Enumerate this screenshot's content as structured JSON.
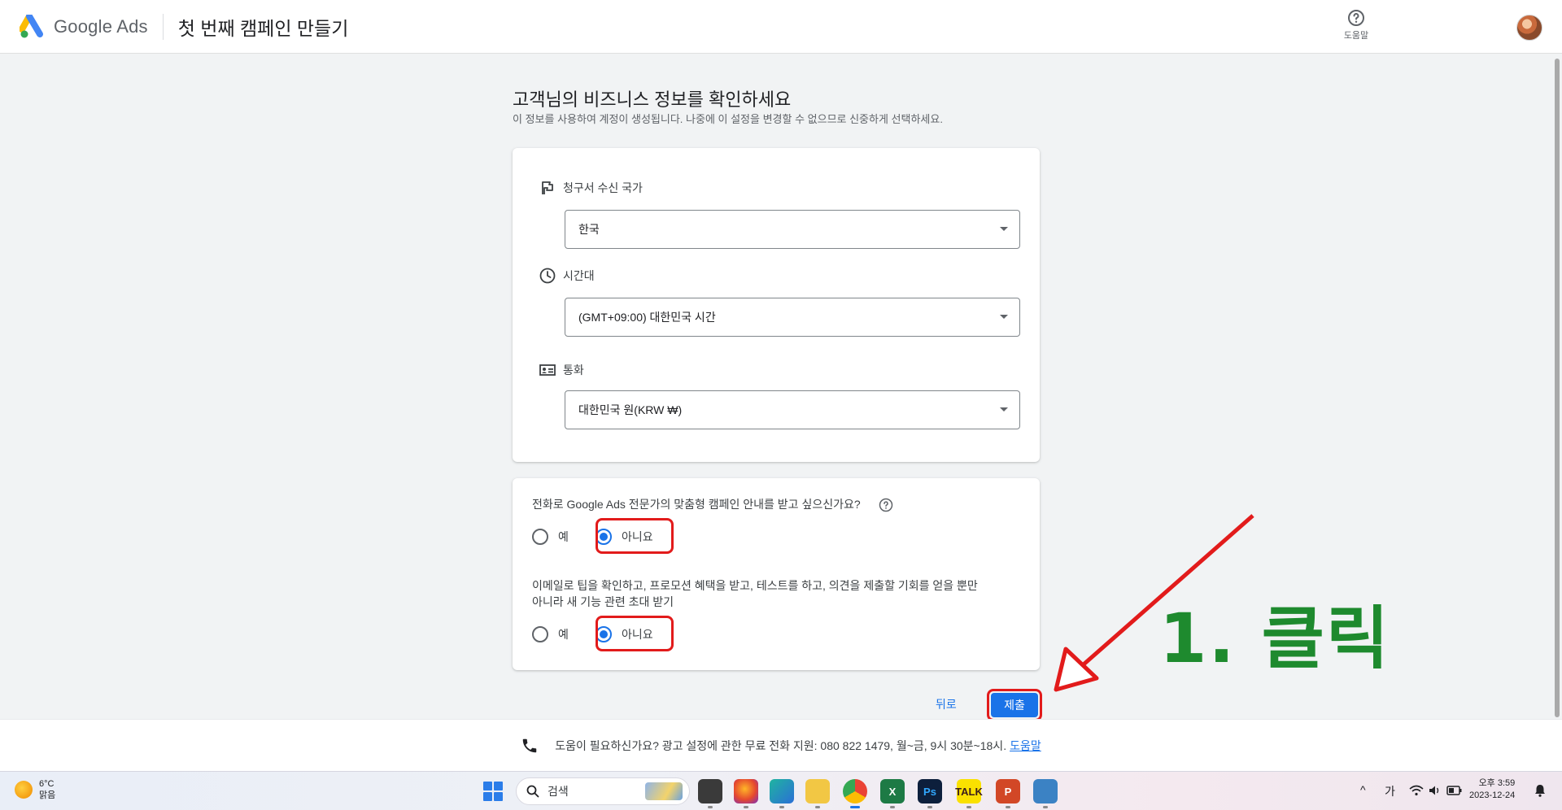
{
  "header": {
    "brand": "Google Ads",
    "page_title": "첫 번째 캠페인 만들기",
    "help_label": "도움말"
  },
  "main": {
    "title": "고객님의 비즈니스 정보를 확인하세요",
    "subtitle": "이 정보를 사용하여 계정이 생성됩니다. 나중에 이 설정을 변경할 수 없으므로 신중하게 선택하세요.",
    "fields": [
      {
        "label": "청구서 수신 국가",
        "icon": "flag-icon",
        "value": "한국"
      },
      {
        "label": "시간대",
        "icon": "clock-icon",
        "value": "(GMT+09:00) 대한민국 시간"
      },
      {
        "label": "통화",
        "icon": "currency-icon",
        "value": "대한민국 원(KRW ₩)"
      }
    ],
    "questions": [
      {
        "text": "전화로 Google Ads 전문가의 맞춤형 캠페인 안내를 받고 싶으신가요?",
        "options": [
          "예",
          "아니요"
        ],
        "selected": "아니요"
      },
      {
        "text_line1": "이메일로 팁을 확인하고, 프로모션 혜택을 받고, 테스트를 하고, 의견을 제출할 기회를 얻을 뿐만",
        "text_line2": "아니라 새 기능 관련 초대 받기",
        "options": [
          "예",
          "아니요"
        ],
        "selected": "아니요"
      }
    ],
    "back_label": "뒤로",
    "submit_label": "제출"
  },
  "annotation": {
    "text": "1. 클릭",
    "color": "#1e8a2e",
    "arrow_color": "#e21b1b"
  },
  "support": {
    "text": "도움이 필요하신가요? 광고 설정에 관한 무료 전화 지원: 080 822 1479, 월~금, 9시 30분~18시.",
    "link": "도움말"
  },
  "taskbar": {
    "weather_temp": "6°C",
    "weather_desc": "맑음",
    "search_placeholder": "검색",
    "ime": "가",
    "time": "오후 3:59",
    "date": "2023-12-24"
  },
  "colors": {
    "accent": "#1a73e8",
    "highlight": "#e21b1b"
  }
}
